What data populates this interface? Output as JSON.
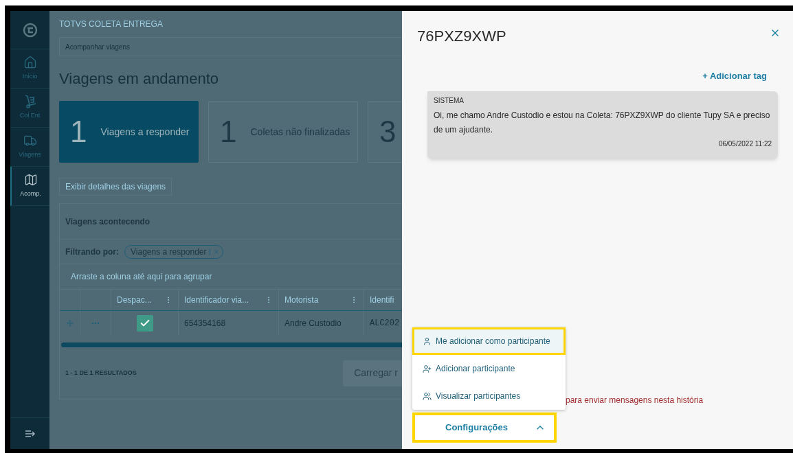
{
  "app_title": "TOTVS COLETA ENTREGA",
  "sidebar": {
    "items": [
      {
        "kind": "home",
        "label": "Início",
        "selected": false
      },
      {
        "kind": "dolly",
        "label": "Col.Ent",
        "selected": false
      },
      {
        "kind": "truck",
        "label": "Viagens",
        "selected": false
      },
      {
        "kind": "map",
        "label": "Acomp.",
        "selected": true
      }
    ]
  },
  "breadcrumb": "Acompanhar viagens",
  "page_title": "Viagens em andamento",
  "summary_cards": [
    {
      "count": "1",
      "label": "Viagens a responder",
      "selected": true
    },
    {
      "count": "1",
      "label": "Coletas não finalizadas",
      "selected": false
    },
    {
      "count": "3",
      "selected": false
    }
  ],
  "details_button": "Exibir detalhes das viagens",
  "trips_panel": {
    "title": "Viagens acontecendo",
    "filter_label": "Filtrando por:",
    "filter_chip": "Viagens a responder",
    "group_hint": "Arraste a coluna até aqui para agrupar",
    "columns": [
      "Despac...",
      "Identificador via...",
      "Motorista",
      "Identifi"
    ],
    "rows": [
      {
        "cells": [
          {
            "kind": "checkbox",
            "checked": true
          },
          {
            "kind": "text",
            "text": "654354168"
          },
          {
            "kind": "text",
            "text": "Andre Custodio"
          },
          {
            "kind": "text",
            "text": "ALC202"
          }
        ]
      }
    ],
    "results": "1 - 1 DE 1 RESULTADOS",
    "load_button": "Carregar r"
  },
  "chat_panel": {
    "title": "76PXZ9XWP",
    "add_tag": "+ Adicionar tag",
    "messages": [
      {
        "sender": "SISTEMA",
        "text": "Oi, me chamo Andre Custodio e estou na Coleta: 76PXZ9XWP do cliente Tupy SA e preciso de um ajudante.",
        "time": "06/05/2022 11:22"
      }
    ],
    "menu": [
      {
        "kind": "self",
        "label": "Me adicionar como participante",
        "highlighted": true
      },
      {
        "kind": "add",
        "label": "Adicionar participante",
        "highlighted": false
      },
      {
        "kind": "view",
        "label": "Visualizar participantes",
        "highlighted": false
      }
    ],
    "notice": "para enviar mensagens nesta história",
    "settings_button": {
      "label": "Configurações",
      "expanded": true,
      "highlighted": true
    }
  }
}
